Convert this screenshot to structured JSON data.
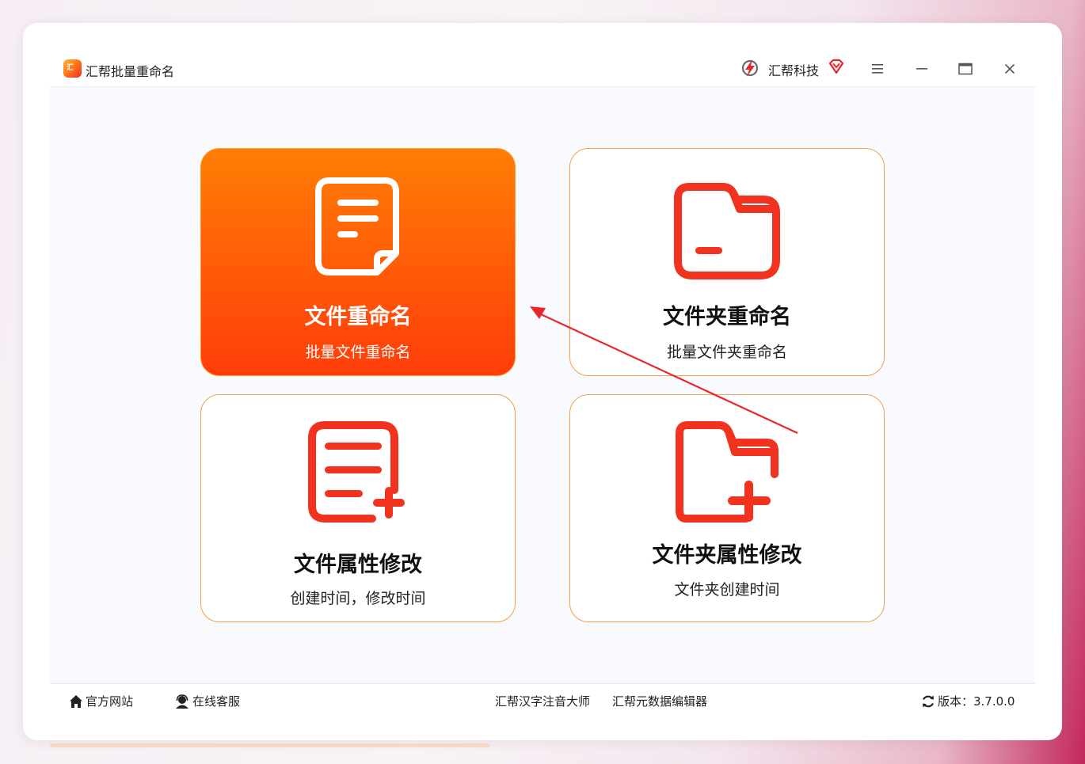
{
  "app": {
    "title": "汇帮批量重命名",
    "logo_text": "汇",
    "brand_name": "汇帮科技"
  },
  "window_controls": {
    "menu": "menu-icon",
    "minimize": "minimize-icon",
    "maximize": "maximize-icon",
    "close": "close-icon"
  },
  "cards": [
    {
      "title": "文件重命名",
      "subtitle": "批量文件重命名",
      "icon": "document-icon",
      "active": true
    },
    {
      "title": "文件夹重命名",
      "subtitle": "批量文件夹重命名",
      "icon": "folder-icon",
      "active": false
    },
    {
      "title": "文件属性修改",
      "subtitle": "创建时间，修改时间",
      "icon": "document-add-icon",
      "active": false
    },
    {
      "title": "文件夹属性修改",
      "subtitle": "文件夹创建时间",
      "icon": "folder-add-icon",
      "active": false
    }
  ],
  "footer": {
    "website": "官方网站",
    "support": "在线客服",
    "pinyin_tool": "汇帮汉字注音大师",
    "metadata_tool": "汇帮元数据编辑器",
    "version": "版本：3.7.0.0"
  },
  "colors": {
    "accent": "#ff5a08",
    "icon_red": "#f0321e",
    "card_border": "#f2a24a"
  }
}
